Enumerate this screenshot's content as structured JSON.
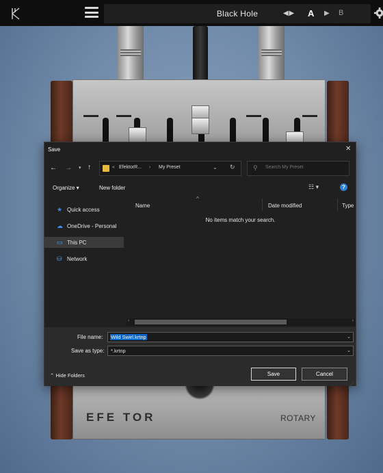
{
  "plugin": {
    "preset_name": "Black Hole",
    "preset_nav": "◀ ▶",
    "ab_a": "A",
    "ab_play": "▶",
    "ab_b": "B",
    "icons": [
      "efektor-logo-icon",
      "hamburger-menu-icon",
      "gear-icon"
    ]
  },
  "device": {
    "brand": "EFE TOR",
    "model": "ROTARY"
  },
  "dialog": {
    "title": "Save",
    "close": "✕",
    "nav": {
      "back": "←",
      "forward": "→",
      "recent": "▾",
      "up": "↑"
    },
    "address": {
      "sep": "«",
      "crumbs": [
        "EfektorR...",
        "My Preset"
      ],
      "crumb_sep": "›",
      "chevron": "⌄",
      "refresh": "↻"
    },
    "search_placeholder": "Search My Preset",
    "toolbar": {
      "organize": "Organize ▾",
      "new_folder": "New folder",
      "view": "☷ ▾",
      "help": "?"
    },
    "nav_pane": [
      {
        "icon": "★",
        "label": "Quick access",
        "icon_color": "#3b8ee8"
      },
      {
        "icon": "☁",
        "label": "OneDrive - Personal",
        "icon_color": "#3b8ee8"
      },
      {
        "icon": "▭",
        "label": "This PC",
        "icon_color": "#4aa3f0"
      },
      {
        "icon": "⛁",
        "label": "Network",
        "icon_color": "#4aa3f0"
      }
    ],
    "columns": [
      "Name",
      "Date modified",
      "Type"
    ],
    "sort_indicator": "^",
    "empty_message": "No items match your search.",
    "file_name_label": "File name:",
    "file_name_value": "Wild Swirl.krtnp",
    "save_type_label": "Save as type:",
    "save_type_value": "*.krtnp",
    "hide_folders": "⌃  Hide Folders",
    "save_button": "Save",
    "cancel_button": "Cancel"
  },
  "colors": {
    "accent": "#0a64c8",
    "folder": "#e8b93c"
  }
}
